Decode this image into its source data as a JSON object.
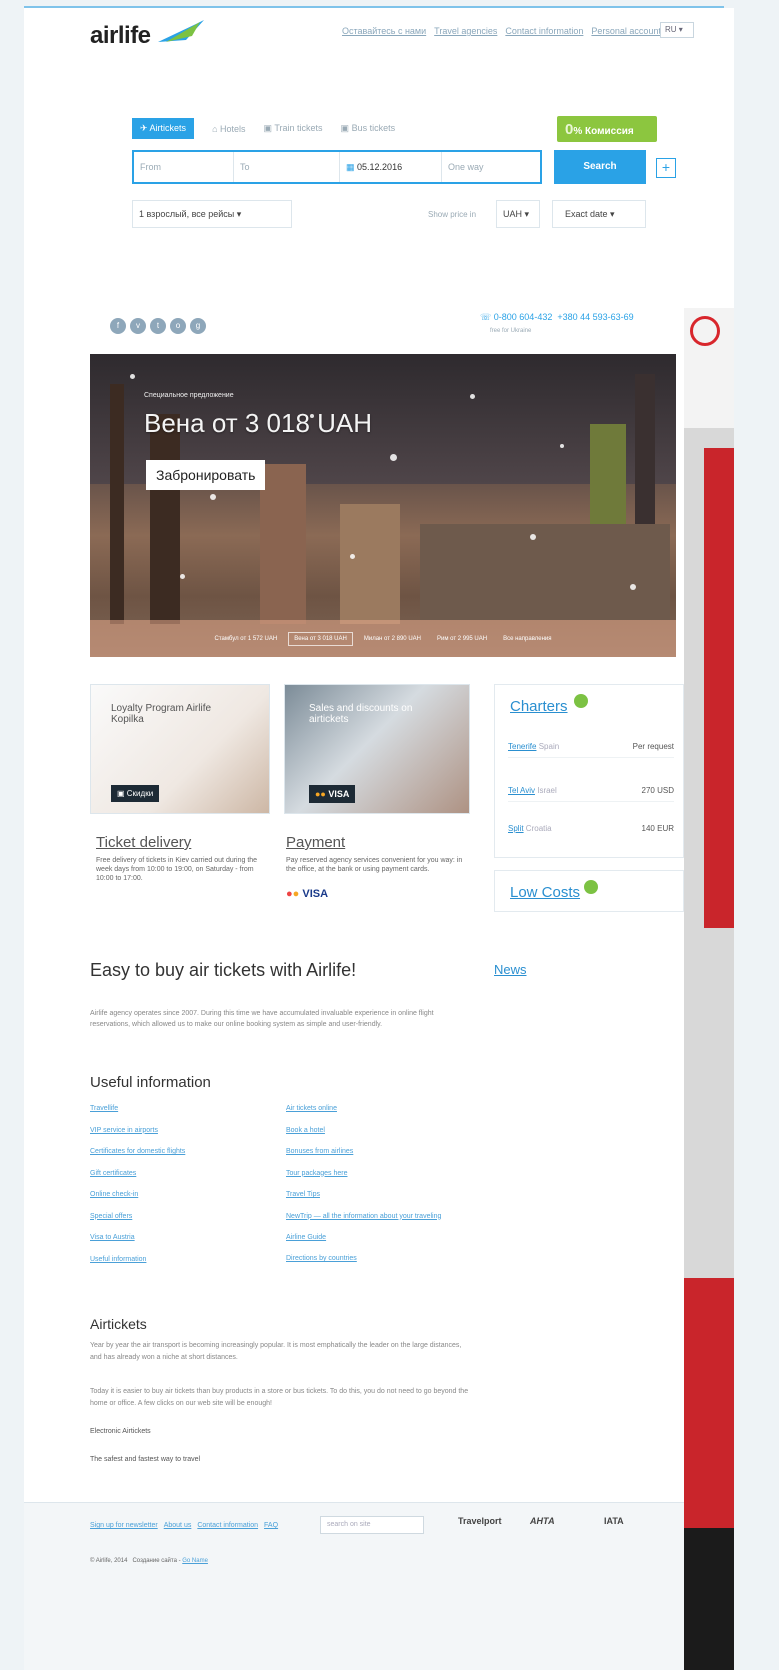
{
  "header": {
    "logo_text": "airlife",
    "nav": [
      "Oставайтесь с нами",
      "Travel agencies",
      "Contact information",
      "Personal account"
    ],
    "lang": "RU"
  },
  "search": {
    "tabs": [
      "Airtickets",
      "Hotels",
      "Train tickets",
      "Bus tickets"
    ],
    "promo_prefix": "0",
    "promo_label": "Комиссия",
    "from_placeholder": "From",
    "to_placeholder": "To",
    "date": "05.12.2016",
    "return_placeholder": "One way",
    "search_button": "Search",
    "passengers": "1 взрослый, все рейсы",
    "show_price_label": "Show price in",
    "currency": "UAH",
    "exact_date": "Exact date"
  },
  "contact": {
    "phone1": "0-800 604-432",
    "phone2": "+380 44 593-63-69",
    "phone_sub": "free for Ukraine"
  },
  "hero": {
    "kicker": "Специальное предложение",
    "title": "Вена от 3 018 UAH",
    "button": "Забронировать",
    "strip": [
      "Стамбул от 1 572 UAH",
      "Вена от 3 018 UAH",
      "Милан от 2 890 UAH",
      "Рим от 2 995 UAH",
      "Все направления"
    ]
  },
  "cards": {
    "loyalty_title": "Loyalty Program Airlife Kopilka",
    "loyalty_badge": "Скидки",
    "sales_title": "Sales and discounts on airtickets",
    "sales_badge": "VISA",
    "delivery_heading": "Ticket delivery",
    "delivery_text": "Free delivery of tickets in Kiev carried out during the week days from 10:00 to 19:00, on Saturday - from 10:00 to 17:00.",
    "payment_heading": "Payment",
    "payment_text": "Pay reserved agency services convenient for you way: in the office, at the bank or using payment cards.",
    "payment_logos": "VISA"
  },
  "charters": {
    "title": "Charters",
    "rows": [
      {
        "city": "Tenerife",
        "country": "Spain",
        "price": "Per request"
      },
      {
        "city": "Tel Aviv",
        "country": "Israel",
        "price": "270 USD"
      },
      {
        "city": "Split",
        "country": "Croatia",
        "price": "140 EUR"
      }
    ],
    "low_costs": "Low Costs"
  },
  "main": {
    "heading": "Easy to buy air tickets with Airlife!",
    "news": "News",
    "intro": "Airlife agency operates since 2007. During this time we have accumulated invaluable experience in online flight reservations, which allowed us to make our online booking system as simple and user-friendly.",
    "useful_heading": "Useful information",
    "useful_left": [
      "Travellife",
      "VIP service in airports",
      "Certificates for domestic flights",
      "Gift certificates",
      "Online check-in",
      "Special offers",
      "Visa to Austria",
      "Useful information"
    ],
    "useful_right": [
      "Air tickets online",
      "Book a hotel",
      "Bonuses from airlines",
      "Tour packages here",
      "Travel Tips",
      "NewTrip — all the information about your traveling",
      "Airline Guide",
      "Directions by countries"
    ],
    "air_heading": "Airtickets",
    "air_p1": "Year by year the air transport is becoming increasingly popular. It is most emphatically the leader on the large distances, and has already won a niche at short distances.",
    "air_p2": "Today it is easier to buy air tickets than buy products in a store or bus tickets. To do this, you do not need to go beyond the home or office. A few clicks on our web site will be enough!",
    "link1": "Electronic Airtickets",
    "link2": "The safest and fastest way to travel"
  },
  "footer": {
    "links": [
      "Sign up for newsletter",
      "About us",
      "Contact information",
      "FAQ"
    ],
    "search_placeholder": "search on site",
    "partners": [
      "Travelport",
      "АНТА",
      "IATA"
    ],
    "copyright": "© Airlife, 2014",
    "made_label": "Создание сайта -",
    "made_link": "Go Name"
  }
}
